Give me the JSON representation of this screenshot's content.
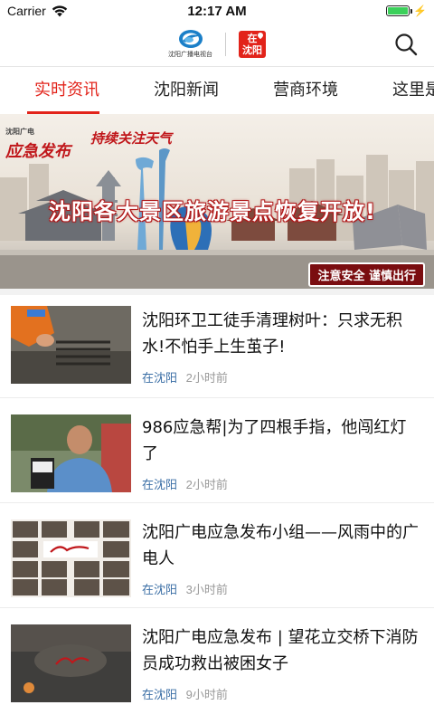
{
  "status_bar": {
    "carrier": "Carrier",
    "time": "12:17 AM"
  },
  "header": {
    "brand_text": "沈阳广播电视台",
    "city_badge_line1": "在",
    "city_badge_line2": "沈阳"
  },
  "tabs": [
    "实时资讯",
    "沈阳新闻",
    "营商环境",
    "这里是"
  ],
  "banner": {
    "brand_small": "沈阳广电",
    "brand": "应急发布",
    "weather": "持续关注天气",
    "headline": "沈阳各大景区旅游景点恢复开放!",
    "tag": "注意安全 谨慎出行"
  },
  "news": [
    {
      "title": "沈阳环卫工徒手清理树叶：只求无积水!不怕手上生茧子!",
      "source": "在沈阳",
      "time": "2小时前"
    },
    {
      "title": "986应急帮|为了四根手指，他闯红灯了",
      "source": "在沈阳",
      "time": "2小时前"
    },
    {
      "title": "沈阳广电应急发布小组——风雨中的广电人",
      "source": "在沈阳",
      "time": "3小时前"
    },
    {
      "title": "沈阳广电应急发布 | 望花立交桥下消防员成功救出被困女子",
      "source": "在沈阳",
      "time": "9小时前"
    }
  ],
  "colors": {
    "accent": "#e2231a",
    "source": "#3a6ea5",
    "meta": "#999999"
  }
}
